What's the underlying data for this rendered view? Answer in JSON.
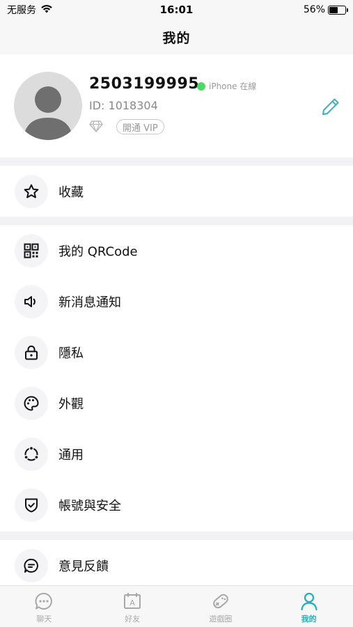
{
  "status_bar": {
    "carrier": "无服务",
    "time": "16:01",
    "battery_percent": "56%",
    "battery_level": 0.56
  },
  "nav": {
    "title": "我的"
  },
  "profile": {
    "username": "2503199995",
    "online_status": "iPhone 在線",
    "user_id": "ID: 1018304",
    "vip_label": "開通 VIP"
  },
  "menu": {
    "favorites": "收藏",
    "qrcode": "我的 QRCode",
    "notifications": "新消息通知",
    "privacy": "隱私",
    "appearance": "外觀",
    "general": "通用",
    "account_security": "帳號與安全",
    "feedback": "意見反饋"
  },
  "tabs": {
    "chat": "聊天",
    "friends": "好友",
    "games": "遊戲圈",
    "me": "我的"
  },
  "colors": {
    "accent": "#1fb0bd",
    "online": "#4cd964",
    "edit_icon": "#3fb5c0"
  }
}
